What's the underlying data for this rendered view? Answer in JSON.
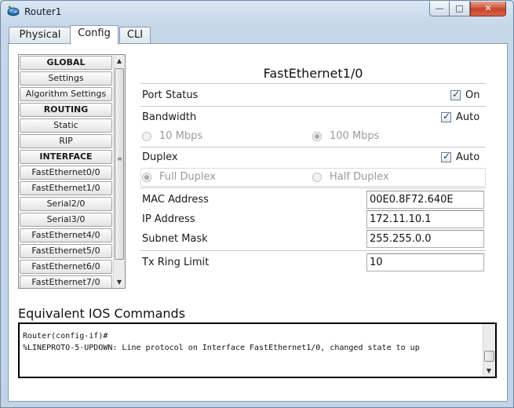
{
  "window": {
    "title": "Router1",
    "controls": {
      "minimize": "—",
      "maximize": "□",
      "close": "✕"
    }
  },
  "tabs": [
    {
      "label": "Physical",
      "active": false
    },
    {
      "label": "Config",
      "active": true
    },
    {
      "label": "CLI",
      "active": false
    }
  ],
  "sidebar": {
    "items": [
      {
        "label": "GLOBAL",
        "header": true
      },
      {
        "label": "Settings",
        "header": false
      },
      {
        "label": "Algorithm Settings",
        "header": false
      },
      {
        "label": "ROUTING",
        "header": true
      },
      {
        "label": "Static",
        "header": false
      },
      {
        "label": "RIP",
        "header": false
      },
      {
        "label": "INTERFACE",
        "header": true
      },
      {
        "label": "FastEthernet0/0",
        "header": false
      },
      {
        "label": "FastEthernet1/0",
        "header": false
      },
      {
        "label": "Serial2/0",
        "header": false
      },
      {
        "label": "Serial3/0",
        "header": false
      },
      {
        "label": "FastEthernet4/0",
        "header": false
      },
      {
        "label": "FastEthernet5/0",
        "header": false
      },
      {
        "label": "FastEthernet6/0",
        "header": false
      },
      {
        "label": "FastEthernet7/0",
        "header": false
      }
    ],
    "scroll_up": "▲",
    "scroll_down": "▼"
  },
  "interface": {
    "title": "FastEthernet1/0",
    "port_status": {
      "label": "Port Status",
      "checkbox_label": "On",
      "checked": true
    },
    "bandwidth": {
      "label": "Bandwidth",
      "auto_label": "Auto",
      "auto_checked": true,
      "option_10": "10 Mbps",
      "option_100": "100 Mbps",
      "selected": "100 Mbps"
    },
    "duplex": {
      "label": "Duplex",
      "auto_label": "Auto",
      "auto_checked": true,
      "option_full": "Full Duplex",
      "option_half": "Half Duplex",
      "selected": "Full Duplex"
    },
    "mac_address": {
      "label": "MAC Address",
      "value": "00E0.8F72.640E"
    },
    "ip_address": {
      "label": "IP Address",
      "value": "172.11.10.1"
    },
    "subnet_mask": {
      "label": "Subnet Mask",
      "value": "255.255.0.0"
    },
    "tx_ring_limit": {
      "label": "Tx Ring Limit",
      "value": "10"
    }
  },
  "ios": {
    "title": "Equivalent IOS Commands",
    "console_text": "Router(config-if)#\n%LINEPROTO-5-UPDOWN: Line protocol on Interface FastEthernet1/0, changed state to up"
  }
}
